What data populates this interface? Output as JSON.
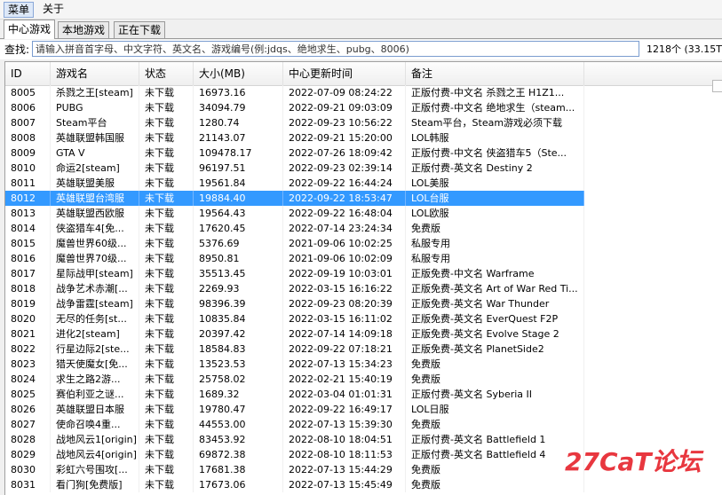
{
  "menubar": {
    "main": "菜单",
    "about": "关于"
  },
  "tabs": [
    "中心游戏",
    "本地游戏",
    "正在下载"
  ],
  "search": {
    "label": "查找:",
    "placeholder": "请输入拼音首字母、中文字符、英文名、游戏编号(例:jdqs、绝地求生、pubg、8006)",
    "count": "1218个 (33.15TB"
  },
  "table": {
    "columns": [
      "ID",
      "游戏名",
      "状态",
      "大小(MB)",
      "中心更新时间",
      "备注"
    ],
    "selected_id": "8012",
    "rows": [
      [
        "8005",
        "杀戮之王[steam]",
        "未下载",
        "16973.16",
        "2022-07-09 08:24:22",
        "正版付费-中文名 杀戮之王 H1Z1..."
      ],
      [
        "8006",
        "PUBG",
        "未下载",
        "34094.79",
        "2022-09-21 09:03:09",
        "正版付费-中文名 绝地求生（steam..."
      ],
      [
        "8007",
        "Steam平台",
        "未下载",
        "1280.74",
        "2022-09-23 10:56:22",
        "Steam平台，Steam游戏必须下载"
      ],
      [
        "8008",
        "英雄联盟韩国服",
        "未下载",
        "21143.07",
        "2022-09-21 15:20:00",
        "LOL韩服"
      ],
      [
        "8009",
        "GTA V",
        "未下载",
        "109478.17",
        "2022-07-26 18:09:42",
        "正版付费-中文名 侠盗猎车5（Ste..."
      ],
      [
        "8010",
        "命运2[steam]",
        "未下载",
        "96197.51",
        "2022-09-23 02:39:14",
        "正版付费-英文名 Destiny 2"
      ],
      [
        "8011",
        "英雄联盟美服",
        "未下载",
        "19561.84",
        "2022-09-22 16:44:24",
        "LOL美服"
      ],
      [
        "8012",
        "英雄联盟台湾服",
        "未下载",
        "19884.40",
        "2022-09-22 18:53:47",
        "LOL台服"
      ],
      [
        "8013",
        "英雄联盟西欧服",
        "未下载",
        "19564.43",
        "2022-09-22 16:48:04",
        "LOL欧服"
      ],
      [
        "8014",
        "侠盗猎车4[免...",
        "未下载",
        "17620.45",
        "2022-07-14 23:24:34",
        "免费版"
      ],
      [
        "8015",
        "魔兽世界60级...",
        "未下载",
        "5376.69",
        "2021-09-06 10:02:25",
        "私服专用"
      ],
      [
        "8016",
        "魔兽世界70级...",
        "未下载",
        "8950.81",
        "2021-09-06 10:02:09",
        "私服专用"
      ],
      [
        "8017",
        "星际战甲[steam]",
        "未下载",
        "35513.45",
        "2022-09-19 10:03:01",
        "正版免费-中文名 Warframe"
      ],
      [
        "8018",
        "战争艺术赤潮[...",
        "未下载",
        "2269.93",
        "2022-03-15 16:16:22",
        "正版免费-英文名 Art of War Red Ti..."
      ],
      [
        "8019",
        "战争雷霆[steam]",
        "未下载",
        "98396.39",
        "2022-09-23 08:20:39",
        "正版免费-英文名 War Thunder"
      ],
      [
        "8020",
        "无尽的任务[st...",
        "未下载",
        "10835.84",
        "2022-03-15 16:11:02",
        "正版免费-英文名 EverQuest F2P"
      ],
      [
        "8021",
        "进化2[steam]",
        "未下载",
        "20397.42",
        "2022-07-14 14:09:18",
        "正版免费-英文名 Evolve Stage 2"
      ],
      [
        "8022",
        "行星边际2[ste...",
        "未下载",
        "18584.83",
        "2022-09-22 07:18:21",
        "正版免费-英文名 PlanetSide2"
      ],
      [
        "8023",
        "猎天使魔女[免...",
        "未下载",
        "13523.53",
        "2022-07-13 15:34:23",
        "免费版"
      ],
      [
        "8024",
        "求生之路2游...",
        "未下载",
        "25758.02",
        "2022-02-21 15:40:19",
        "免费版"
      ],
      [
        "8025",
        "赛伯利亚之谜...",
        "未下载",
        "1689.32",
        "2022-03-04 01:01:31",
        "正版付费-英文名 Syberia II"
      ],
      [
        "8026",
        "英雄联盟日本服",
        "未下载",
        "19780.47",
        "2022-09-22 16:49:17",
        "LOL日服"
      ],
      [
        "8027",
        "使命召唤4重...",
        "未下载",
        "44553.00",
        "2022-07-13 15:39:30",
        "免费版"
      ],
      [
        "8028",
        "战地风云1[origin]",
        "未下载",
        "83453.92",
        "2022-08-10 18:04:51",
        "正版付费-英文名 Battlefield 1"
      ],
      [
        "8029",
        "战地风云4[origin]",
        "未下载",
        "69872.38",
        "2022-08-10 18:11:53",
        "正版付费-英文名 Battlefield 4"
      ],
      [
        "8030",
        "彩虹六号围攻[...",
        "未下载",
        "17681.38",
        "2022-07-13 15:44:29",
        "免费版"
      ],
      [
        "8031",
        "看门狗[免费版]",
        "未下载",
        "17673.06",
        "2022-07-13 15:45:49",
        "免费版"
      ]
    ]
  },
  "watermark": {
    "text": "27CaT论坛",
    "color": "#e8373f"
  }
}
